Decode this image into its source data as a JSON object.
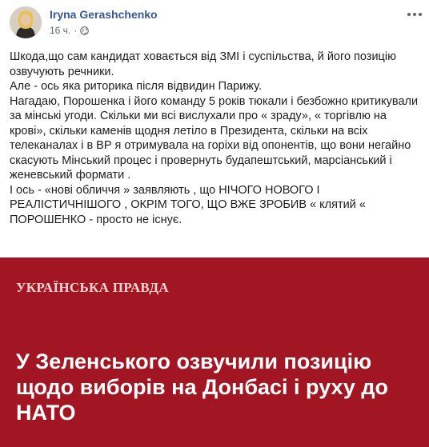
{
  "post": {
    "author": "Iryna Gerashchenko",
    "time": "16 ч.",
    "separator": "·",
    "privacy_icon": "globe-icon",
    "more_icon": "more-options-icon",
    "paragraphs": [
      "Шкода,що сам кандидат ховається від ЗМІ і суспільства, й його позицію озвучують речники.",
      "Але - ось яка риторика після відвидин Парижу.",
      "Нагадаю, Порошенка і його команду 5 років тюкали і безбожно критикували за мінські угоди. Скільки ми всі вислухали про « зраду», « торгівлю на крові», скільки каменів щодня летіло в Президента, скільки на всіх телеканалах і в ВР я отримувала на горіхи від опонентів, що вони негайно скасують Мінський процес і провернуть будапештський, марсіанський і женевський формати .",
      "І ось - «нові обличчя » заявляють , що НІЧОГО НОВОГО І РЕАЛІСТИЧНІШОГО , ОКРІМ ТОГО, ЩО ВЖЕ ЗРОБИВ « клятий « ПОРОШЕНКО - просто не існує."
    ]
  },
  "preview": {
    "source": "УКРАЇНСЬКА ПРАВДА",
    "headline": "У Зеленського озвучили позицію щодо виборів на Донбасі і руху до НАТО",
    "background": "#a21523"
  },
  "colors": {
    "author": "#385898",
    "meta": "#606770",
    "text": "#1c1e21"
  }
}
